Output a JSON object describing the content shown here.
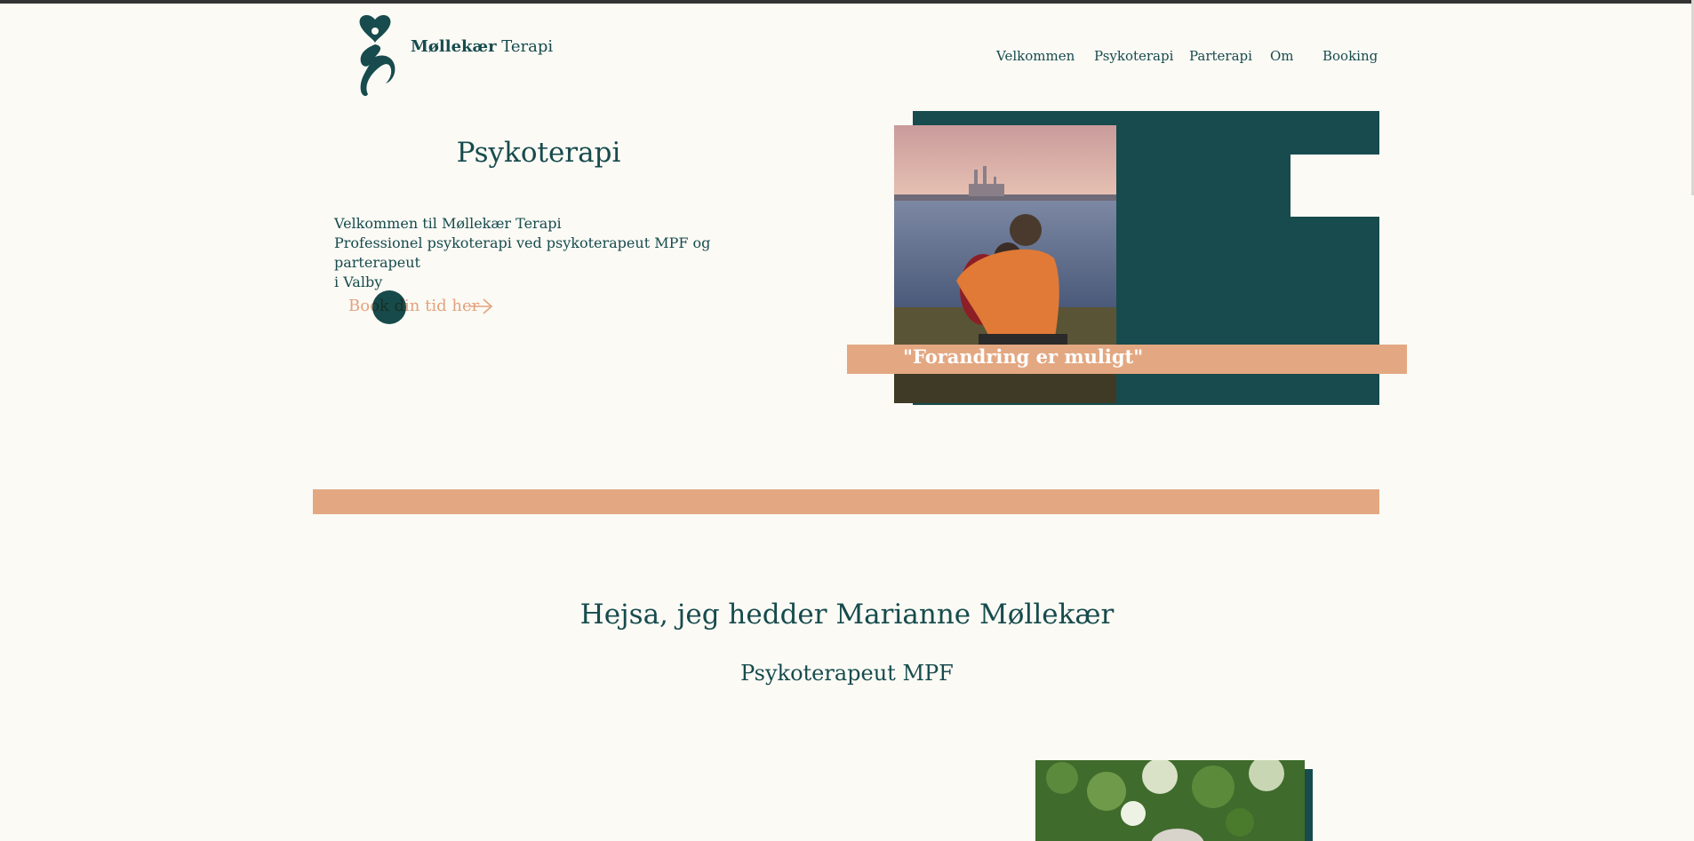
{
  "header": {
    "brand_bold": "Møllekær",
    "brand_rest": " Terapi",
    "nav": [
      "Velkommen",
      "Psykoterapi",
      "Parterapi",
      "Om",
      "Booking"
    ]
  },
  "hero": {
    "title": "Psykoterapi",
    "intro_lines": [
      "Velkommen til Møllekær Terapi",
      "Professionel psykoterapi ved psykoterapeut MPF og parterapeut",
      "i Valby"
    ],
    "cta_label": "Book din tid her",
    "quote": "\"Forandring er muligt\""
  },
  "about": {
    "heading": "Hejsa, jeg hedder Marianne Møllekær",
    "role": "Psykoterapeut MPF"
  },
  "colors": {
    "brand_teal": "#174b4d",
    "accent_peach": "#e3a882",
    "background": "#fbfaf5"
  }
}
